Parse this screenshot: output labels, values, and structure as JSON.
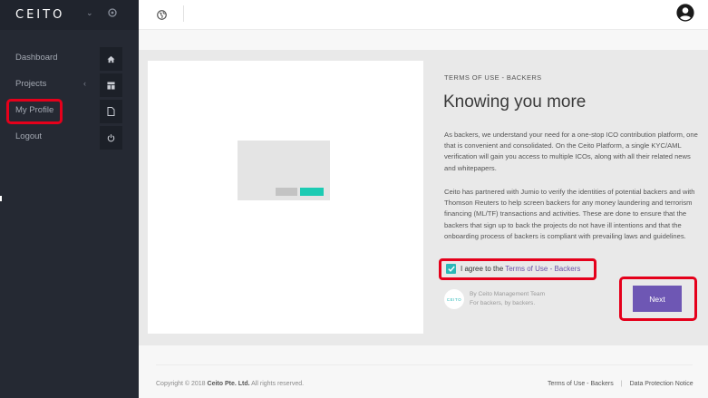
{
  "brand": {
    "name": "CEITO",
    "chevron": "⌄",
    "settings_icon": "gear-icon"
  },
  "sidebar": {
    "items": [
      {
        "label": "Dashboard",
        "icon": "home-icon"
      },
      {
        "label": "Projects",
        "chevron": "‹",
        "icon": "grid-icon"
      },
      {
        "label": "My Profile",
        "icon": "document-icon",
        "highlighted": true
      },
      {
        "label": "Logout",
        "icon": "power-icon"
      }
    ]
  },
  "topbar": {
    "language_icon": "globe-icon",
    "account_icon": "user-icon"
  },
  "main": {
    "breadcrumb": "TERMS OF USE - BACKERS",
    "title": "Knowing you more",
    "paragraph1": "As backers, we understand your need for a one-stop ICO contribution platform, one that is convenient and consolidated. On the Ceito Platform, a single KYC/AML verification will gain you access to multiple ICOs, along with all their related news and whitepapers.",
    "paragraph2": "Ceito has partnered with Jumio to verify the identities of potential backers and with Thomson Reuters to help screen backers for any money laundering and terrorism financing (ML/TF) transactions and activities. These are done to ensure that the backers that sign up to back the projects do not have ill intentions and that the onboarding process of backers is compliant with prevailing laws and guidelines.",
    "agree_prefix": "I agree to the ",
    "agree_link": "Terms of Use - Backers",
    "agree_checked": true,
    "team_logo_text": "CEITO",
    "team_name": "By Ceito Management Team",
    "team_tagline": "For backers, by backers.",
    "next_label": "Next"
  },
  "footer": {
    "copyright_prefix": "Copyright © 2018 ",
    "copyright_company": "Ceito Pte. Ltd.",
    "copyright_suffix": " All rights reserved.",
    "terms_link": "Terms of Use - Backers",
    "separator": "|",
    "privacy_link": "Data Protection Notice"
  },
  "colors": {
    "sidebar_bg": "#252933",
    "accent_purple": "#6e57b4",
    "accent_teal": "#2bb8b8",
    "highlight_red": "#e5001b"
  }
}
